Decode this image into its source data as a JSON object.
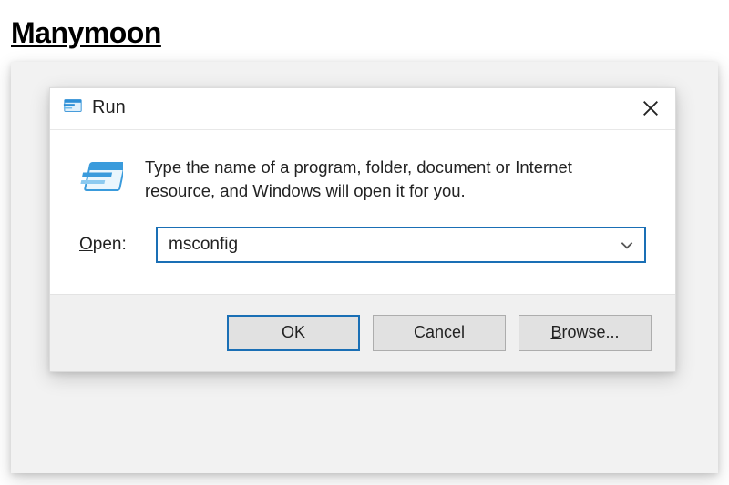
{
  "brand": "Manymoon",
  "dialog": {
    "title": "Run",
    "instruction": "Type the name of a program, folder, document or Internet resource, and Windows will open it for you.",
    "open_label_mnemonic": "O",
    "open_label_rest": "pen:",
    "input_value": "msconfig",
    "buttons": {
      "ok": "OK",
      "cancel": "Cancel",
      "browse_mnemonic": "B",
      "browse_rest": "rowse..."
    }
  }
}
